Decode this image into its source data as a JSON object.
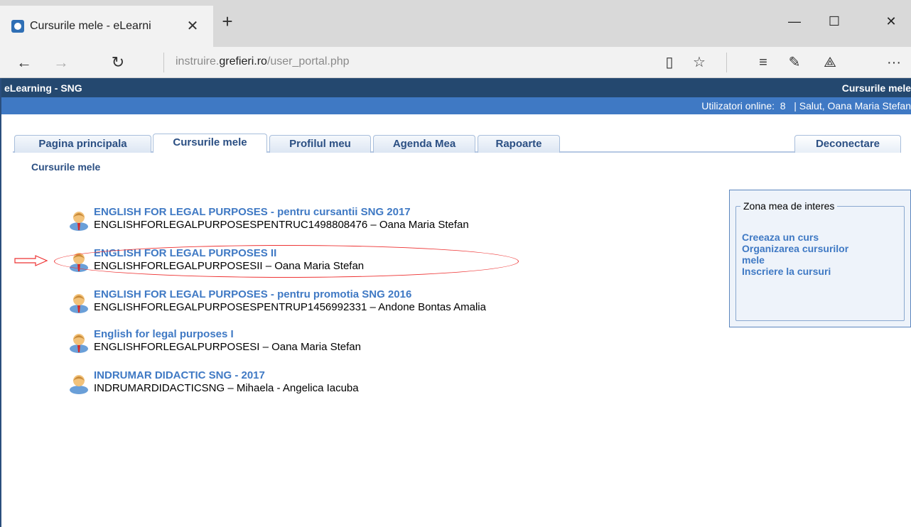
{
  "browser": {
    "tab_title": "Cursurile mele - eLearni",
    "url_prefix": "instruire.",
    "url_host": "grefieri.ro",
    "url_path": "/user_portal.php"
  },
  "header": {
    "site_name": "eLearning - SNG",
    "section": "Cursurile mele",
    "online_label": "Utilizatori online:",
    "online_count": "8",
    "greeting": "| Salut, Oana Maria Stefan"
  },
  "tabs": [
    {
      "label": "Pagina principala"
    },
    {
      "label": "Cursurile mele"
    },
    {
      "label": "Profilul meu"
    },
    {
      "label": "Agenda Mea"
    },
    {
      "label": "Rapoarte"
    }
  ],
  "logout_label": "Deconectare",
  "breadcrumb": "Cursurile mele",
  "courses": [
    {
      "title": "ENGLISH FOR LEGAL PURPOSES - pentru cursantii SNG 2017",
      "info": "ENGLISHFORLEGALPURPOSESPENTRUC1498808476 – Oana Maria Stefan"
    },
    {
      "title": "ENGLISH FOR LEGAL PURPOSES II",
      "info": "ENGLISHFORLEGALPURPOSESII – Oana Maria Stefan"
    },
    {
      "title": "ENGLISH FOR LEGAL PURPOSES - pentru promotia SNG 2016",
      "info": "ENGLISHFORLEGALPURPOSESPENTRUP1456992331 – Andone Bontas Amalia"
    },
    {
      "title": "English for legal purposes I",
      "info": "ENGLISHFORLEGALPURPOSESI – Oana Maria Stefan"
    },
    {
      "title": "INDRUMAR DIDACTIC SNG - 2017",
      "info": "INDRUMARDIDACTICSNG – Mihaela - Angelica Iacuba"
    }
  ],
  "interest": {
    "legend": "Zona mea de interes",
    "link1": "Creeaza un curs",
    "link2a": "Organizarea cursurilor",
    "link2b": "mele",
    "link3": "Inscriere la cursuri"
  }
}
